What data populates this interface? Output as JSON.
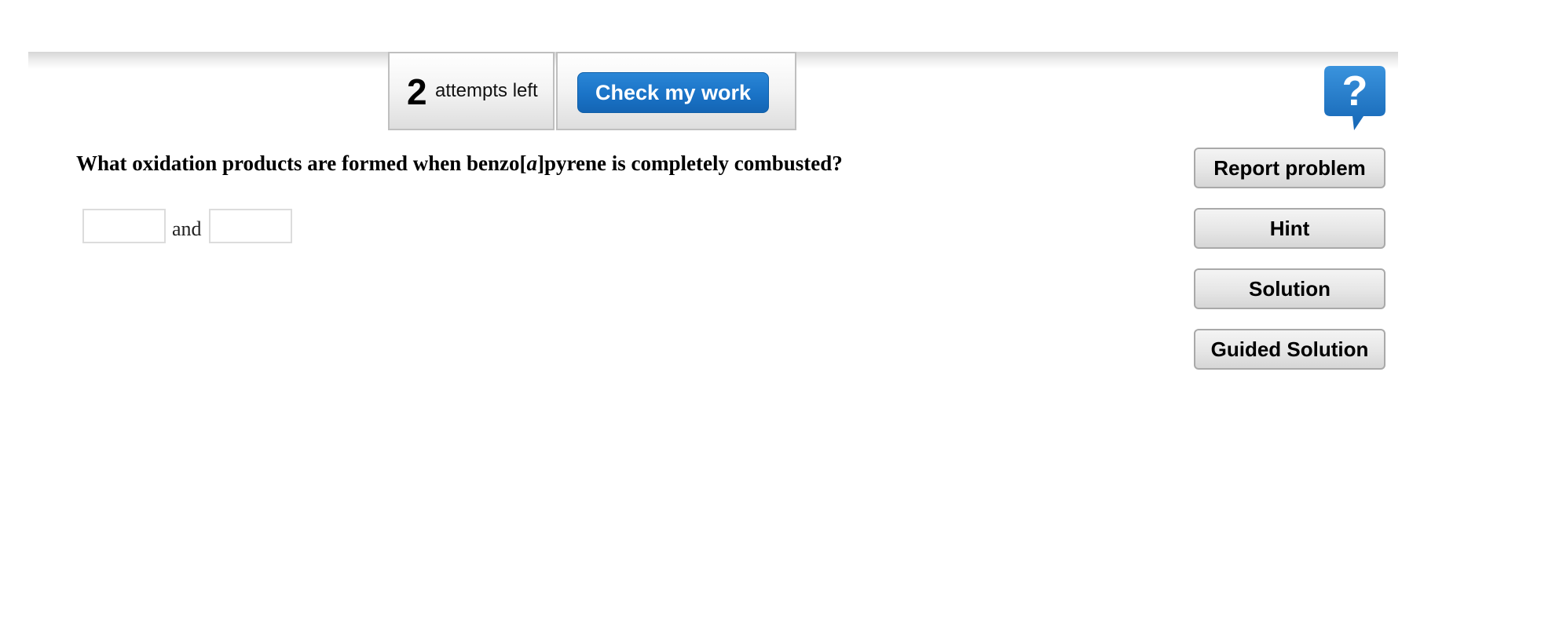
{
  "toolbar": {
    "attempts_count": "2",
    "attempts_label": "attempts left",
    "check_label": "Check my work"
  },
  "help": {
    "icon": "question-speech-bubble-icon",
    "glyph": "?",
    "color": "#1f78c8"
  },
  "question": {
    "prefix": "What oxidation products are formed when benzo[",
    "italic": "a",
    "suffix": "]pyrene is completely combusted?"
  },
  "answer": {
    "value_1": "",
    "connector": "and",
    "value_2": ""
  },
  "sidebar": {
    "report_label": "Report problem",
    "hint_label": "Hint",
    "solution_label": "Solution",
    "guided_label": "Guided Solution"
  },
  "colors": {
    "accent": "#1a73c7",
    "button_text": "#ffffff"
  }
}
